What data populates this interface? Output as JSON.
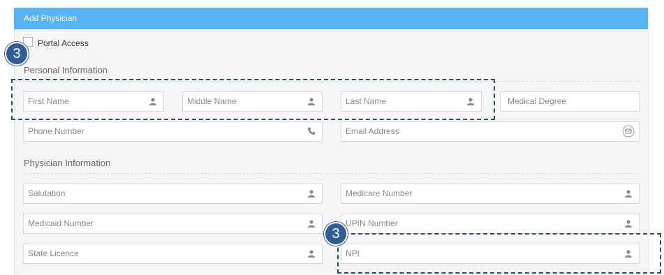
{
  "header": {
    "title": "Add Physician"
  },
  "portal_access": {
    "label": "Portal Access",
    "checked": false
  },
  "sections": {
    "personal": "Personal Information",
    "physician": "Physician Information"
  },
  "fields": {
    "first_name": {
      "placeholder": "First Name",
      "icon": "user-icon"
    },
    "middle_name": {
      "placeholder": "Middle Name",
      "icon": "user-icon"
    },
    "last_name": {
      "placeholder": "Last Name",
      "icon": "user-icon"
    },
    "medical_degree": {
      "placeholder": "Medical Degree"
    },
    "phone_number": {
      "placeholder": "Phone Number",
      "icon": "phone-icon"
    },
    "email_address": {
      "placeholder": "Email Address",
      "icon": "envelope-icon"
    },
    "salutation": {
      "placeholder": "Salutation",
      "icon": "user-icon"
    },
    "medicare_number": {
      "placeholder": "Medicare Number",
      "icon": "user-icon"
    },
    "medicaid_number": {
      "placeholder": "Medicaid Number",
      "icon": "user-icon"
    },
    "upin_number": {
      "placeholder": "UPIN Number",
      "icon": "user-icon"
    },
    "state_licence": {
      "placeholder": "State Licence",
      "icon": "user-icon"
    },
    "npi": {
      "placeholder": "NPI",
      "icon": "user-icon"
    }
  },
  "annotations": {
    "badge_top": "3",
    "badge_bottom": "3"
  },
  "colors": {
    "header": "#57b3f5",
    "annotation": "#2f5e96",
    "panel": "#f5f5f5"
  }
}
